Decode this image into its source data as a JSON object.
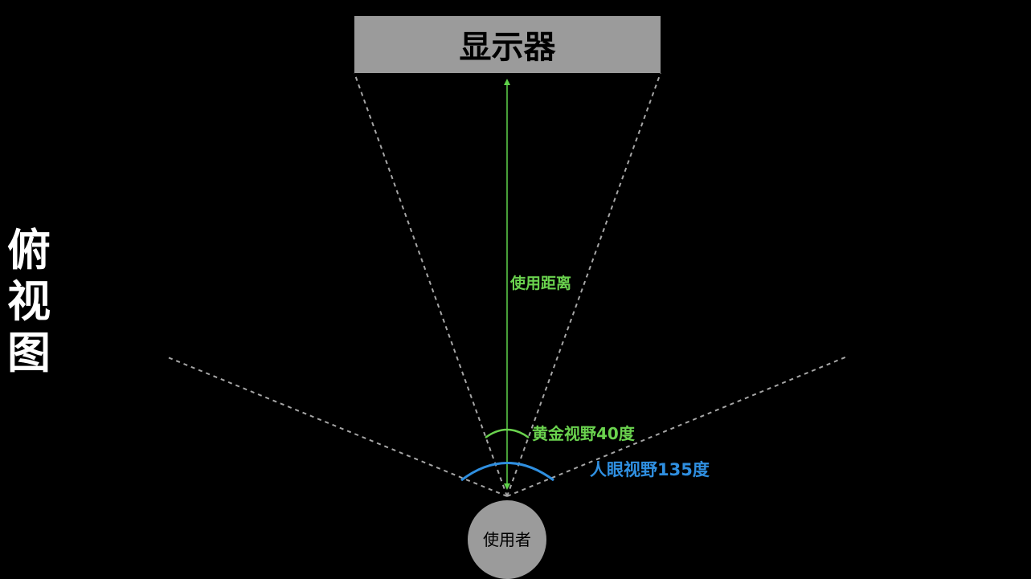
{
  "side_title": [
    "俯",
    "视",
    "图"
  ],
  "monitor": {
    "label": "显示器"
  },
  "distance": {
    "label": "使用距离"
  },
  "golden_fov": {
    "label": "黄金视野40度"
  },
  "human_fov": {
    "label": "人眼视野135度"
  },
  "user": {
    "label": "使用者"
  },
  "colors": {
    "background": "#000000",
    "monitor_fill": "#9b9b9b",
    "user_fill": "#9b9b9b",
    "sight_lines": "#a6a6a6",
    "distance": "#5fd34a",
    "golden_fov": "#6ad24e",
    "human_fov": "#2f8fe0",
    "side_title": "#ffffff"
  }
}
